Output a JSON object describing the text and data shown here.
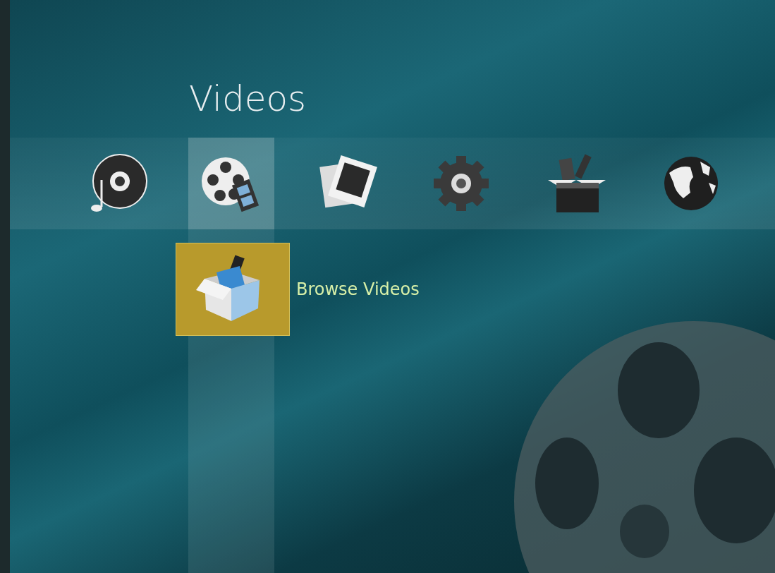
{
  "title": "Videos",
  "categories": [
    {
      "kind": "music",
      "selected": false
    },
    {
      "kind": "videos",
      "selected": true
    },
    {
      "kind": "pictures",
      "selected": false
    },
    {
      "kind": "settings",
      "selected": false
    },
    {
      "kind": "programs",
      "selected": false
    },
    {
      "kind": "weather",
      "selected": false
    }
  ],
  "submenu": [
    {
      "label": "Browse Videos",
      "kind": "browse",
      "selected": true
    }
  ]
}
